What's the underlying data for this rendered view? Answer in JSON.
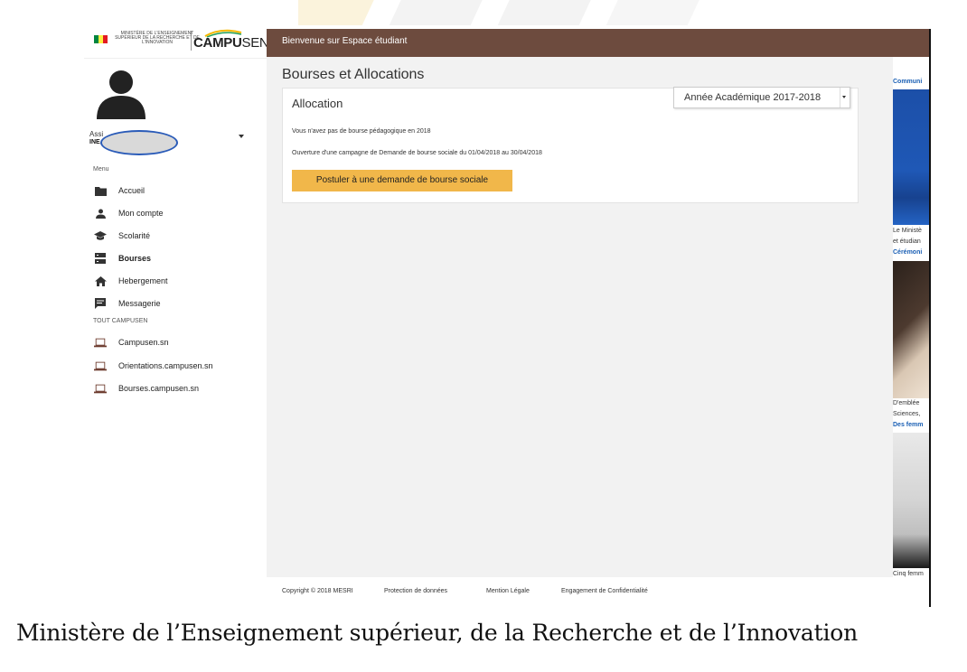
{
  "brand": {
    "ministry_text": "MINISTÈRE DE L'ENSEIGNEMENT SUPÉRIEUR DE LA RECHERCHE ET DE L'INNOVATION",
    "logo_text_bold": "CAMPU",
    "logo_text_regular": "SEN",
    "flag_colors": [
      "#00853f",
      "#fdef42",
      "#e31b23"
    ]
  },
  "header": {
    "welcome": "Bienvenue sur Espace étudiant",
    "bar_color": "#6d4b3e"
  },
  "user": {
    "assign_label": "Assi",
    "ine_label": "INE",
    "avatar_icon": "user-silhouette-icon"
  },
  "sidebar": {
    "menu_title": "Menu",
    "items": [
      {
        "label": "Accueil",
        "icon": "folder-icon"
      },
      {
        "label": "Mon compte",
        "icon": "person-icon"
      },
      {
        "label": "Scolarité",
        "icon": "graduation-cap-icon"
      },
      {
        "label": "Bourses",
        "icon": "server-icon"
      },
      {
        "label": "Hebergement",
        "icon": "home-icon"
      },
      {
        "label": "Messagerie",
        "icon": "message-icon"
      }
    ],
    "section2_title": "TOUT CAMPUSEN",
    "links": [
      {
        "label": "Campusen.sn",
        "icon": "laptop-icon"
      },
      {
        "label": "Orientations.campusen.sn",
        "icon": "laptop-icon"
      },
      {
        "label": "Bourses.campusen.sn",
        "icon": "laptop-icon"
      }
    ]
  },
  "main": {
    "page_title": "Bourses et Allocations",
    "card_title": "Allocation",
    "year_select": "Année Académique 2017-2018",
    "message1": "Vous n'avez pas de bourse pédagogique en 2018",
    "message2": "Ouverture d'une campagne de Demande de bourse sociale du 01/04/2018 au 30/04/2018",
    "apply_button": "Postuler à une demande de bourse sociale",
    "button_color": "#f1b74a"
  },
  "footer": {
    "copyright": "Copyright © 2018 MESRI",
    "links": [
      "Protection de données",
      "Mention Légale",
      "Engagement de Confidentialité"
    ]
  },
  "news": {
    "title": "Communi",
    "item1_text": [
      "Le Ministè",
      "et étudian"
    ],
    "item1_link": "Cérémoni",
    "item2_text": [
      "D'emblée",
      "Sciences,"
    ],
    "item2_link": "Des femm",
    "item3_text": "Cinq femm"
  },
  "caption": "Ministère de l’Enseignement supérieur, de la Recherche et de l’Innovation"
}
